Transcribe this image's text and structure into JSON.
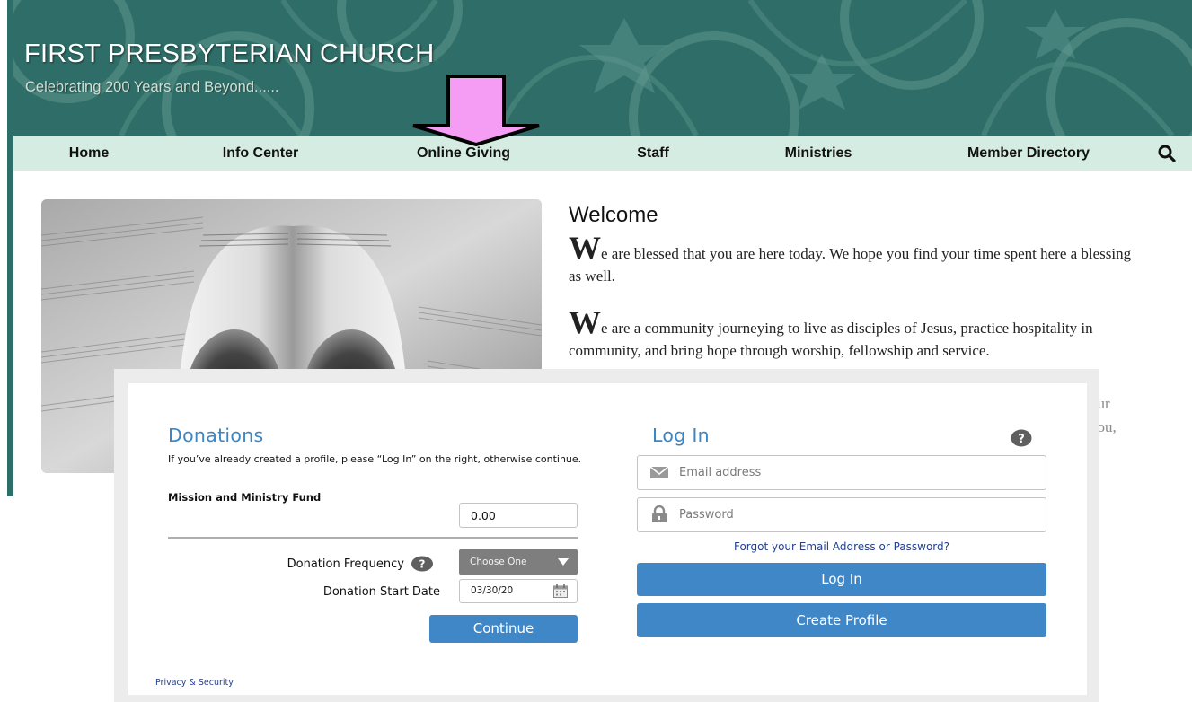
{
  "site": {
    "title": "FIRST PRESBYTERIAN CHURCH",
    "tagline": "Celebrating 200 Years and Beyond......",
    "nav": [
      {
        "label": "Home"
      },
      {
        "label": "Info Center"
      },
      {
        "label": "Online Giving"
      },
      {
        "label": "Staff"
      },
      {
        "label": "Ministries"
      },
      {
        "label": "Member Directory"
      }
    ],
    "search_icon": "search-icon",
    "hero_image": "sheet-music-heart-photo",
    "welcome": {
      "title": "Welcome",
      "para1_cap": "W",
      "para1_rest": "e are blessed that you are here today. We hope you find your time spent here a blessing as well.",
      "para2_cap": "W",
      "para2_rest": "e are a community journeying to live as disciples of Jesus, practice hospitality in community, and bring hope through worship, fellowship and service.",
      "peek_line1": "our",
      "peek_line2": "you,"
    },
    "colors": {
      "banner": "#2f6e68",
      "nav_bg": "#d5ece3",
      "arrow_fill": "#f59cf5"
    }
  },
  "donations": {
    "title": "Donations",
    "intro": "If you’ve already created a profile, please “Log In” on the right, otherwise continue.",
    "fund_label": "Mission and Ministry Fund",
    "fund_amount": "0.00",
    "frequency_label": "Donation Frequency",
    "frequency_value": "Choose One",
    "start_date_label": "Donation Start Date",
    "start_date_value": "03/30/20",
    "continue_label": "Continue",
    "privacy_label": "Privacy & Security"
  },
  "login": {
    "title": "Log In",
    "email_placeholder": "Email address",
    "password_placeholder": "Password",
    "forgot_label": "Forgot your Email Address or Password?",
    "login_label": "Log In",
    "create_label": "Create Profile",
    "accent_color": "#3f87c7"
  }
}
